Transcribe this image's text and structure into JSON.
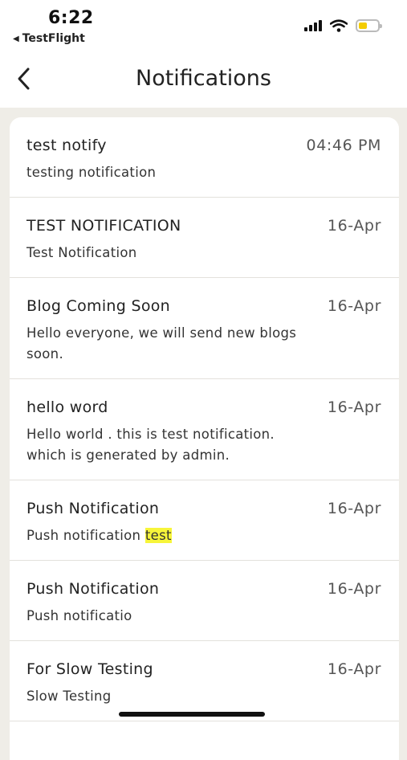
{
  "status_bar": {
    "time": "6:22",
    "back_app": "TestFlight",
    "icons": [
      "signal-icon",
      "wifi-icon",
      "battery-icon"
    ]
  },
  "nav": {
    "title": "Notifications",
    "back_icon": "chevron-left-icon"
  },
  "notifications": [
    {
      "title": "test notify",
      "date": "04:46 PM",
      "body": "testing notification"
    },
    {
      "title": "TEST NOTIFICATION",
      "date": "16-Apr",
      "body": "Test Notification"
    },
    {
      "title": "Blog Coming Soon",
      "date": "16-Apr",
      "body": "Hello everyone, we will send new blogs soon."
    },
    {
      "title": "hello word",
      "date": "16-Apr",
      "body": "Hello world . this is test notification. which is generated by admin."
    },
    {
      "title": "Push Notification",
      "date": "16-Apr",
      "body": "Push notification ",
      "body_highlight": "test"
    },
    {
      "title": "Push Notification",
      "date": "16-Apr",
      "body": "Push notificatio"
    },
    {
      "title": "For Slow Testing",
      "date": "16-Apr",
      "body": "Slow Testing"
    }
  ],
  "colors": {
    "background": "#efede7",
    "highlight": "#f7f53a",
    "battery": "#f4cc00"
  }
}
